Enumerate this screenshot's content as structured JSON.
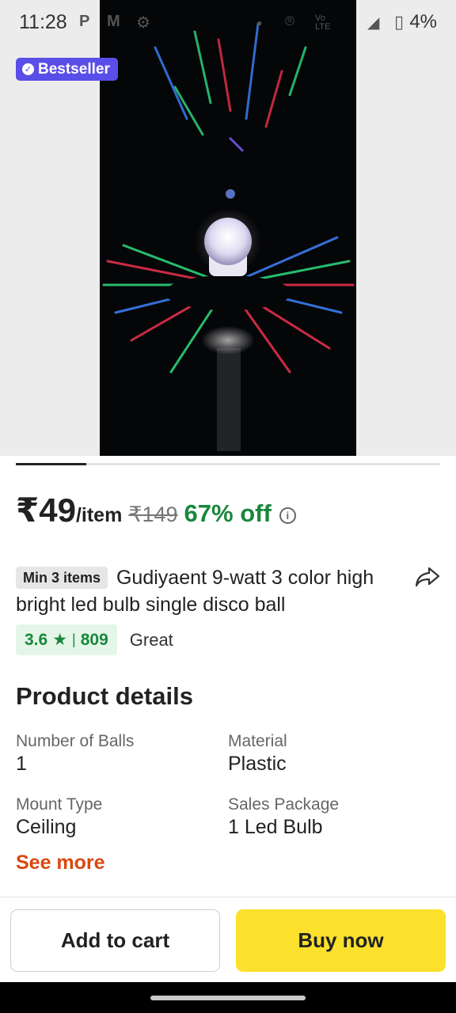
{
  "status_bar": {
    "time": "11:28",
    "battery": "4%",
    "icons": [
      "p-icon",
      "m-icon",
      "settings-icon",
      "dot-icon",
      "location-icon",
      "volte-icon",
      "signal-icon",
      "battery-icon"
    ]
  },
  "product": {
    "badge": "Bestseller",
    "price": "₹49",
    "price_unit": "/item",
    "mrp": "₹149",
    "discount": "67% off",
    "min_qty": "Min 3 items",
    "title": "Gudiyaent 9-watt 3 color high bright led bulb single disco ball",
    "rating": "3.6",
    "rating_star": "★",
    "rating_sep": "|",
    "rating_count": "809",
    "rating_word": "Great"
  },
  "details": {
    "heading": "Product details",
    "specs": [
      {
        "key": "Number of Balls",
        "value": "1"
      },
      {
        "key": "Material",
        "value": "Plastic"
      },
      {
        "key": "Mount Type",
        "value": "Ceiling"
      },
      {
        "key": "Sales Package",
        "value": "1 Led Bulb"
      }
    ],
    "see_more": "See more"
  },
  "actions": {
    "add_to_cart": "Add to cart",
    "buy_now": "Buy now"
  },
  "colors": {
    "accent_purple": "#5a4ee8",
    "discount_green": "#19873d",
    "see_more_orange": "#d9480f",
    "buy_yellow": "#fbe12c"
  },
  "carousel": {
    "active_index": 0
  }
}
